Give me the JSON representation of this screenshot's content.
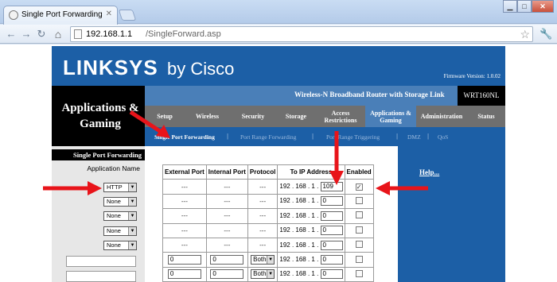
{
  "browser": {
    "tab_title": "Single Port Forwarding",
    "tab_close": "✕",
    "url_host": "192.168.1.1",
    "url_path": "/SingleForward.asp",
    "window_buttons": [
      "▁",
      "□",
      "✕"
    ]
  },
  "router": {
    "logo_text": "LINKSYS",
    "logo_suffix": "by Cisco",
    "firmware": "Firmware Version: 1.0.02",
    "section_title": "Applications & Gaming",
    "product_name": "Wireless-N Broadband Router with Storage Link",
    "model": "WRT160NL",
    "main_tabs": [
      "Setup",
      "Wireless",
      "Security",
      "Storage",
      "Access Restrictions",
      "Applications & Gaming",
      "Administration",
      "Status"
    ],
    "active_main_tab": "Applications & Gaming",
    "sub_tabs": [
      "Single Port Forwarding",
      "Port Range Forwarding",
      "Port Range Triggering",
      "DMZ",
      "QoS"
    ],
    "active_sub_tab": "Single Port Forwarding",
    "left_header": "Single Port Forwarding",
    "left_subheader": "Application Name",
    "app_selects": [
      "HTTP",
      "None",
      "None",
      "None",
      "None"
    ],
    "help_link": "Help..."
  },
  "table": {
    "headers": [
      "External Port",
      "Internal Port",
      "Protocol",
      "To IP Address",
      "Enabled"
    ],
    "ip_prefix": "192 . 168 . 1 .",
    "rows": [
      {
        "ext": "---",
        "int": "---",
        "proto": "---",
        "ip_last": "109",
        "enabled": true,
        "editable": false
      },
      {
        "ext": "---",
        "int": "---",
        "proto": "---",
        "ip_last": "0",
        "enabled": false,
        "editable": false
      },
      {
        "ext": "---",
        "int": "---",
        "proto": "---",
        "ip_last": "0",
        "enabled": false,
        "editable": false
      },
      {
        "ext": "---",
        "int": "---",
        "proto": "---",
        "ip_last": "0",
        "enabled": false,
        "editable": false
      },
      {
        "ext": "---",
        "int": "---",
        "proto": "---",
        "ip_last": "0",
        "enabled": false,
        "editable": false
      },
      {
        "ext": "0",
        "int": "0",
        "proto": "Both",
        "ip_last": "0",
        "enabled": false,
        "editable": true
      },
      {
        "ext": "0",
        "int": "0",
        "proto": "Both",
        "ip_last": "0",
        "enabled": false,
        "editable": true
      }
    ]
  },
  "colors": {
    "brand_blue": "#1c5fa6",
    "annotation_red": "#e8141a"
  }
}
